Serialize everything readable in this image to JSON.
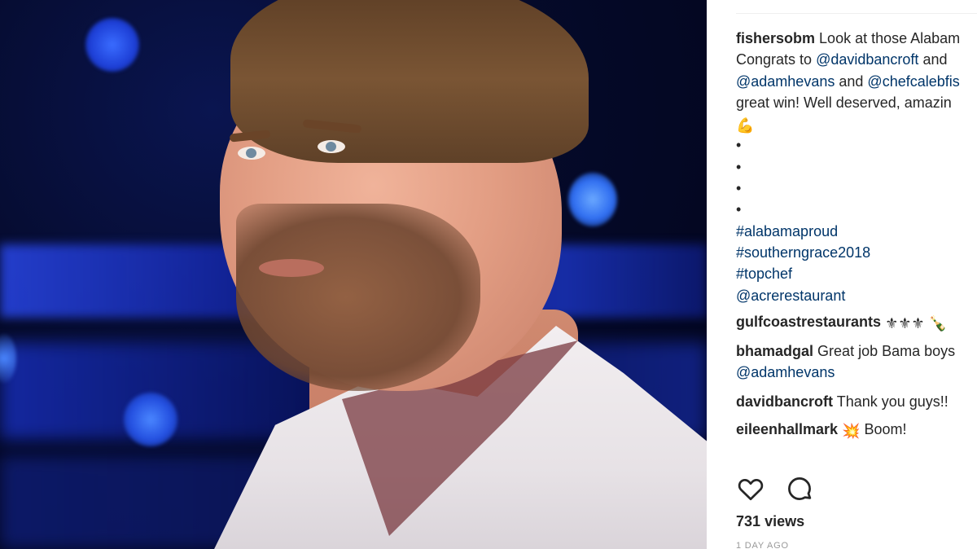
{
  "post": {
    "caption_user": "fishersobm",
    "caption_lines": {
      "l1_text": "Look at those Alabam",
      "l2_text": "Congrats to",
      "l2_mention": "@davidbancroft",
      "l2_tail": "and",
      "l3_mention1": "@adamhevans",
      "l3_and": "and",
      "l3_mention2": "@chefcalebfis",
      "l4_text": "great win! Well deserved, amazin",
      "l5_emoji": "💪",
      "dots": [
        "•",
        "•",
        "•",
        "•"
      ],
      "hashtags": [
        "#alabamaproud",
        "#southerngrace2018",
        "#topchef"
      ],
      "mention_last": "@acrerestaurant"
    }
  },
  "comments": [
    {
      "user": "gulfcoastrestaurants",
      "text": "⚜⚜⚜",
      "tail_emoji": "🍾"
    },
    {
      "user": "bhamadgal",
      "text": "Great job Bama boys",
      "mention": "@adamhevans"
    },
    {
      "user": "davidbancroft",
      "text": "Thank you guys!!"
    },
    {
      "user": "eileenhallmark",
      "emoji": "💥",
      "text": "Boom!"
    }
  ],
  "actions": {
    "like_icon": "heart-icon",
    "comment_icon": "comment-bubble-icon"
  },
  "stats": {
    "views_count": "731",
    "views_label": "views",
    "time_ago": "1 DAY AGO"
  },
  "colors": {
    "link": "#003569",
    "text": "#262626",
    "muted": "#999999"
  }
}
